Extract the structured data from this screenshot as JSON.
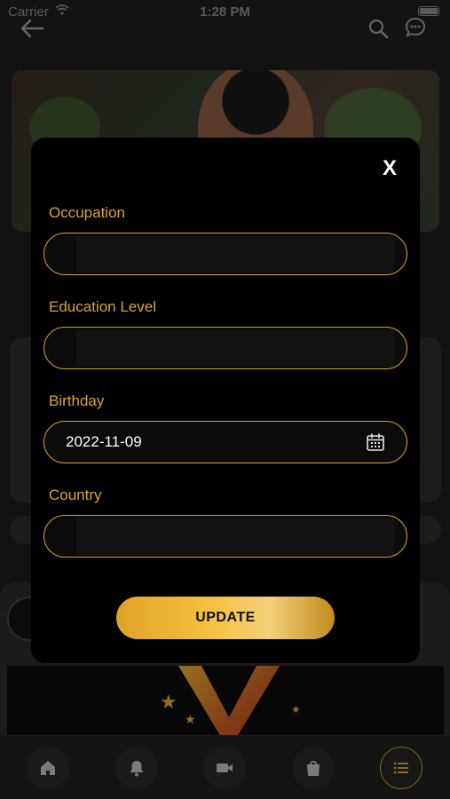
{
  "status_bar": {
    "carrier": "Carrier",
    "time": "1:28 PM"
  },
  "header": {
    "back_icon": "arrow-left-icon",
    "search_icon": "search-icon",
    "chat_icon": "chat-bubble-icon"
  },
  "modal": {
    "close_label": "X",
    "fields": [
      {
        "label": "Occupation",
        "value": "",
        "placeholder": ""
      },
      {
        "label": "Education Level",
        "value": "",
        "placeholder": ""
      },
      {
        "label": "Birthday",
        "value": "2022-11-09",
        "placeholder": ""
      },
      {
        "label": "Country",
        "value": "",
        "placeholder": ""
      }
    ],
    "update_label": "UPDATE",
    "accent_color": "#d9a52e"
  },
  "tabbar": {
    "items": [
      {
        "icon": "home-icon",
        "active": false
      },
      {
        "icon": "bell-icon",
        "active": false
      },
      {
        "icon": "video-camera-icon",
        "active": false
      },
      {
        "icon": "shopping-bag-icon",
        "active": false
      },
      {
        "icon": "menu-list-icon",
        "active": true
      }
    ]
  }
}
